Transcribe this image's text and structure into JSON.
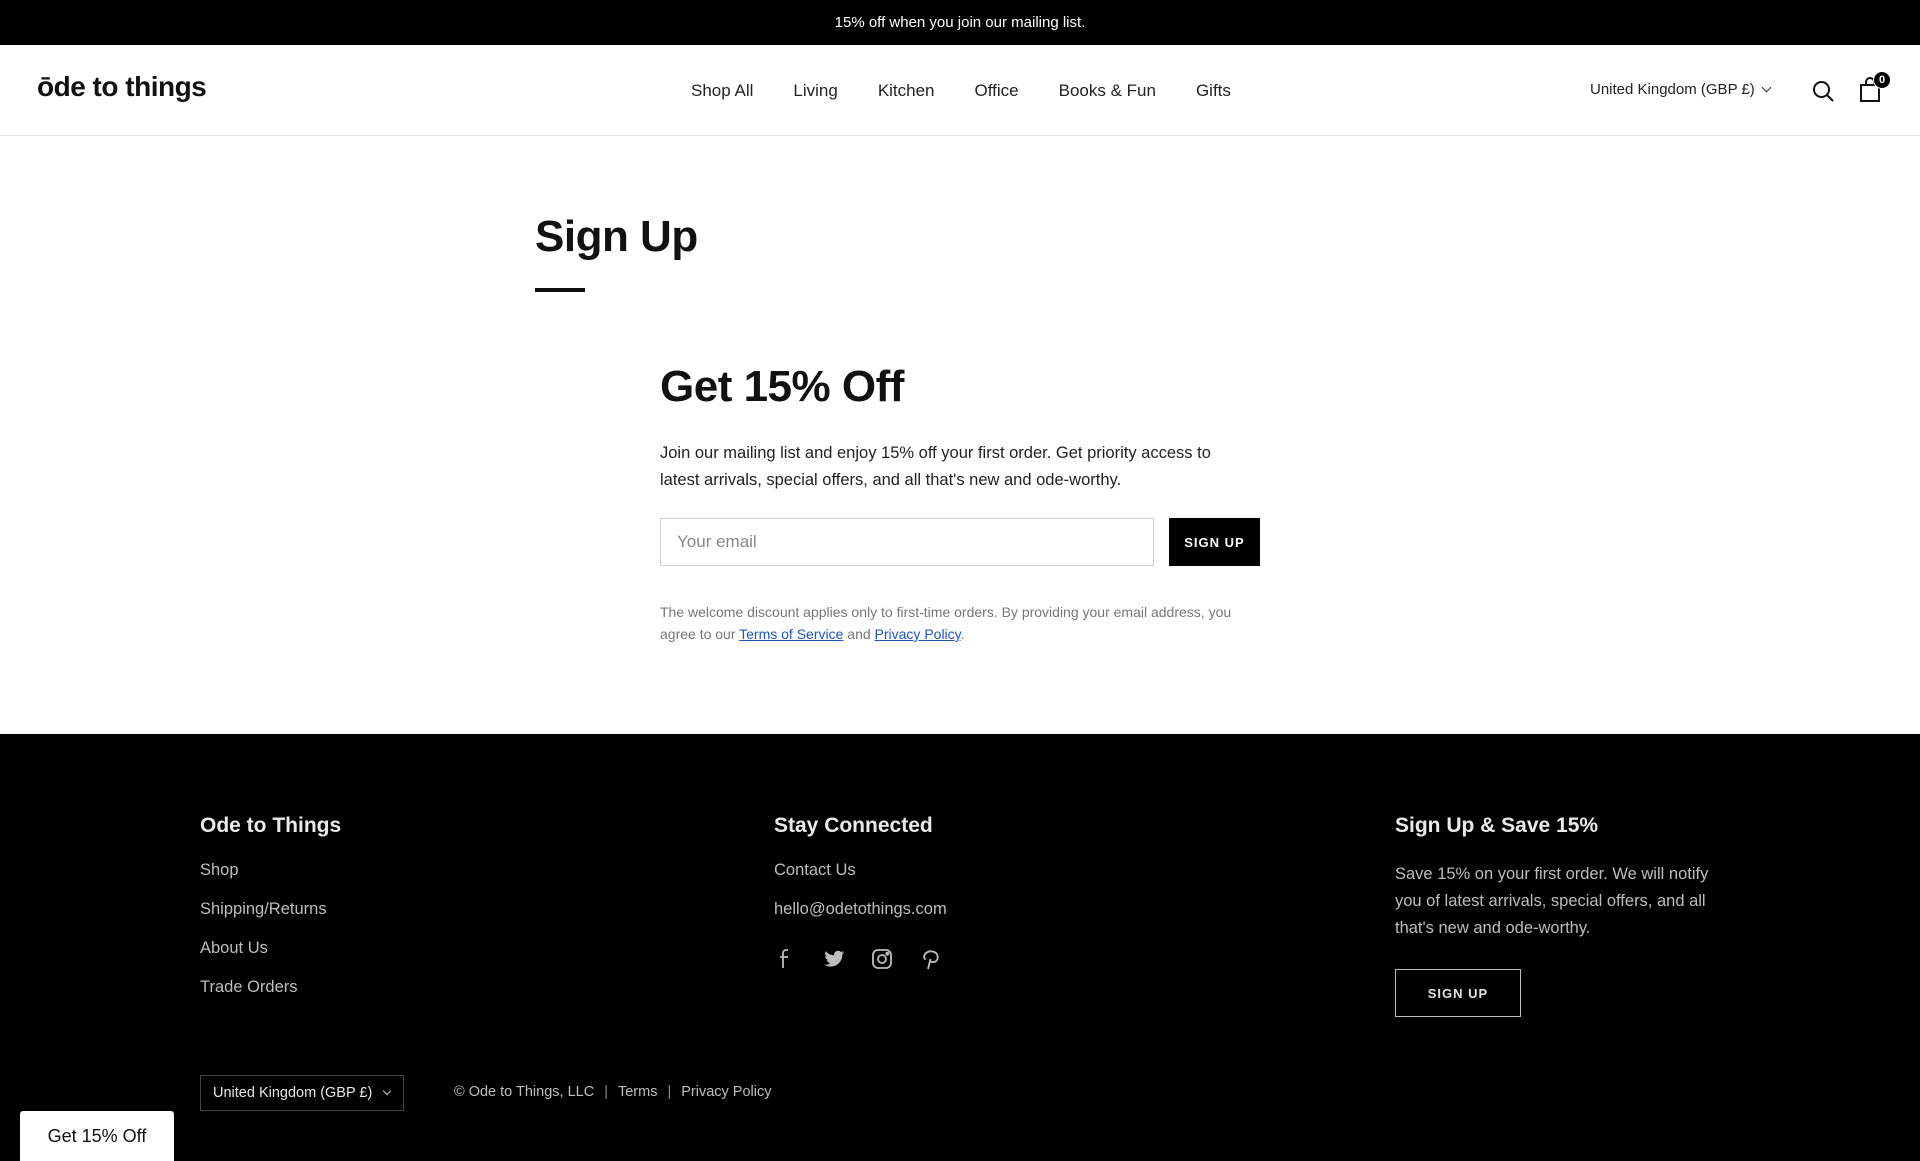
{
  "announcement": "15% off when you join our mailing list.",
  "header": {
    "logo": "ōde to things",
    "nav": [
      "Shop All",
      "Living",
      "Kitchen",
      "Office",
      "Books & Fun",
      "Gifts"
    ],
    "country": "United Kingdom (GBP £)",
    "cart_count": "0",
    "icons": [
      "search-icon",
      "cart-icon",
      "chevron-down-icon"
    ]
  },
  "main": {
    "page_title": "Sign Up",
    "heading": "Get 15% Off",
    "text": "Join our mailing list and enjoy 15% off your first order. Get priority access to latest arrivals, special offers, and all that's new and ode-worthy.",
    "email_placeholder": "Your email",
    "signup_label": "SIGN UP",
    "disclaimer_pre": "The welcome discount applies only to first-time orders. By providing your email address, you agree to our ",
    "terms_link": "Terms of Service",
    "and": " and ",
    "privacy_link": "Privacy Policy",
    "period": "."
  },
  "footer": {
    "col1": {
      "title": "Ode to Things",
      "links": [
        "Shop",
        "Shipping/Returns",
        "About Us",
        "Trade Orders"
      ]
    },
    "col2": {
      "title": "Stay Connected",
      "links": [
        "Contact Us",
        "hello@odetothings.com"
      ],
      "social": [
        "facebook-icon",
        "twitter-icon",
        "instagram-icon",
        "pinterest-icon"
      ]
    },
    "col3": {
      "title": "Sign Up & Save 15%",
      "text": "Save 15% on your first order. We will notify you of latest arrivals, special offers, and all that's new and ode-worthy.",
      "button": "SIGN UP"
    },
    "country": "United Kingdom (GBP £)",
    "copyright": "© Ode to Things, LLC",
    "sep": "|",
    "terms": "Terms",
    "privacy": "Privacy Policy"
  },
  "popup_tab": "Get 15% Off",
  "colors": {
    "primary": "#000000",
    "link": "#1f56b8",
    "background": "#ffffff"
  }
}
